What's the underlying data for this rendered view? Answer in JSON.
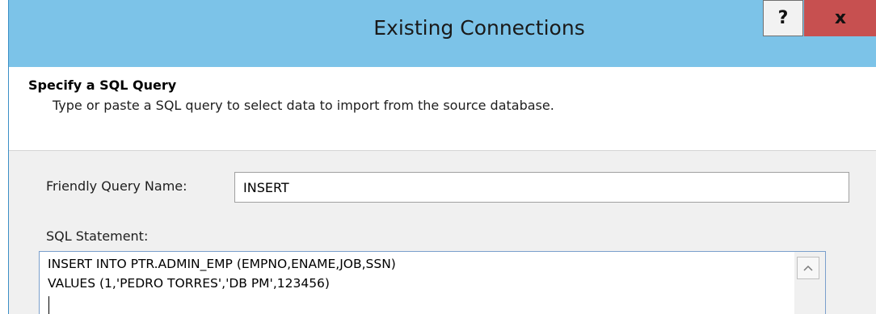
{
  "window": {
    "title": "Existing Connections",
    "help_label": "?",
    "close_label": "x"
  },
  "header": {
    "title": "Specify a SQL Query",
    "description": "Type or paste a SQL query to select data to import from the source database."
  },
  "form": {
    "friendly_query_name_label": "Friendly Query Name:",
    "friendly_query_name_value": "INSERT",
    "sql_statement_label": "SQL Statement:",
    "sql_lines": [
      "INSERT INTO PTR.ADMIN_EMP (EMPNO,ENAME,JOB,SSN)",
      "VALUES (1,'PEDRO TORRES','DB PM',123456)"
    ]
  },
  "icons": {
    "scroll_up": "chevron-up-icon"
  },
  "colors": {
    "titlebar": "#7cc3e8",
    "close_button": "#c75050"
  }
}
